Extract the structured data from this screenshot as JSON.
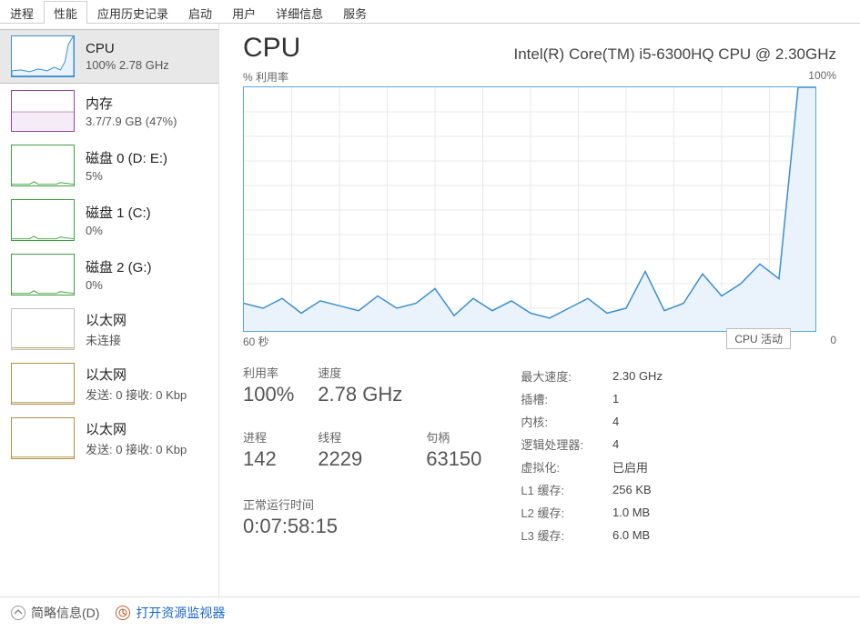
{
  "tabs": [
    "进程",
    "性能",
    "应用历史记录",
    "启动",
    "用户",
    "详细信息",
    "服务"
  ],
  "active_tab_index": 1,
  "sidebar": [
    {
      "title": "CPU",
      "sub": "100%  2.78 GHz",
      "color": "#3b8fd0"
    },
    {
      "title": "内存",
      "sub": "3.7/7.9 GB (47%)",
      "color": "#9b3fa0"
    },
    {
      "title": "磁盘 0 (D: E:)",
      "sub": "5%",
      "color": "#3fa03f"
    },
    {
      "title": "磁盘 1 (C:)",
      "sub": "0%",
      "color": "#3fa03f"
    },
    {
      "title": "磁盘 2 (G:)",
      "sub": "0%",
      "color": "#3fa03f"
    },
    {
      "title": "以太网",
      "sub": "未连接",
      "color": "#b09040"
    },
    {
      "title": "以太网",
      "sub": "发送: 0 接收: 0 Kbp",
      "color": "#b09040"
    },
    {
      "title": "以太网",
      "sub": "发送: 0 接收: 0 Kbp",
      "color": "#b09040"
    }
  ],
  "selected_sidebar_index": 0,
  "main": {
    "title": "CPU",
    "model": "Intel(R) Core(TM) i5-6300HQ CPU @ 2.30GHz",
    "chart_label_left": "% 利用率",
    "chart_label_right": "100%",
    "chart_x_left": "60 秒",
    "chart_x_right": "0",
    "tooltip": "CPU 活动",
    "stats_left": [
      {
        "label": "利用率",
        "value": "100%"
      },
      {
        "label": "速度",
        "value": "2.78 GHz"
      },
      {
        "label": "",
        "value": ""
      },
      {
        "label": "进程",
        "value": "142"
      },
      {
        "label": "线程",
        "value": "2229"
      },
      {
        "label": "句柄",
        "value": "63150"
      }
    ],
    "uptime_label": "正常运行时间",
    "uptime_value": "0:07:58:15",
    "stats_right": [
      [
        "最大速度:",
        "2.30 GHz"
      ],
      [
        "插槽:",
        "1"
      ],
      [
        "内核:",
        "4"
      ],
      [
        "逻辑处理器:",
        "4"
      ],
      [
        "虚拟化:",
        "已启用"
      ],
      [
        "L1 缓存:",
        "256 KB"
      ],
      [
        "L2 缓存:",
        "1.0 MB"
      ],
      [
        "L3 缓存:",
        "6.0 MB"
      ]
    ]
  },
  "footer": {
    "summary": "简略信息(D)",
    "monitor": "打开资源监视器"
  },
  "chart_data": {
    "type": "line",
    "title": "% 利用率",
    "xlabel": "60 秒 → 0",
    "ylabel": "% 利用率",
    "ylim": [
      0,
      100
    ],
    "x": [
      60,
      58,
      56,
      54,
      52,
      50,
      48,
      46,
      44,
      42,
      40,
      38,
      36,
      34,
      32,
      30,
      28,
      26,
      24,
      22,
      20,
      18,
      16,
      14,
      12,
      10,
      8,
      6,
      4,
      2,
      0
    ],
    "values": [
      12,
      10,
      14,
      8,
      13,
      11,
      9,
      15,
      10,
      12,
      18,
      7,
      14,
      9,
      13,
      8,
      6,
      10,
      14,
      8,
      10,
      25,
      9,
      12,
      24,
      15,
      20,
      28,
      22,
      100,
      100
    ]
  }
}
